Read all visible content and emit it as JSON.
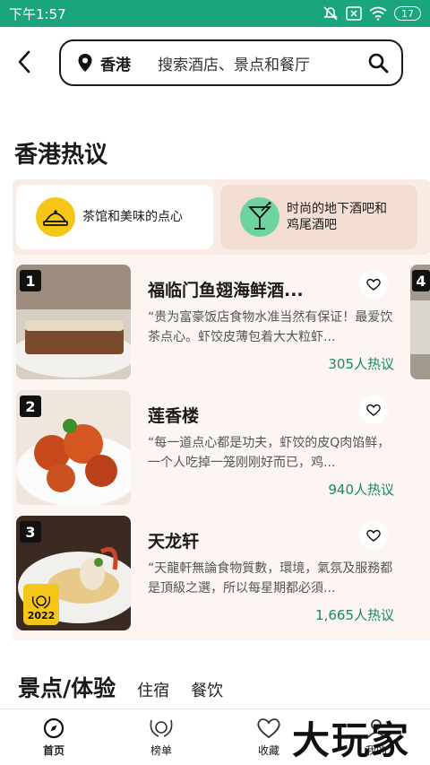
{
  "status_bar": {
    "time": "下午1:57",
    "battery": "17"
  },
  "search": {
    "location": "香港",
    "placeholder": "搜索酒店、景点和餐厅"
  },
  "section_title": "香港热议",
  "topics": [
    {
      "label": "茶馆和美味的点心",
      "icon": "dim-sum-icon",
      "color": "#f5c518"
    },
    {
      "label_line1": "时尚的地下酒吧和",
      "label_line2": "鸡尾酒吧",
      "icon": "cocktail-icon",
      "color": "#6fd3a0"
    }
  ],
  "cards": [
    {
      "rank": "1",
      "name": "福临门鱼翅海鲜酒...",
      "desc": "“贵为富豪饭店食物水准当然有保证！最爱饮茶点心。虾饺皮薄包着大大粒虾...",
      "count": "305人热议"
    },
    {
      "rank": "2",
      "name": "莲香楼",
      "desc": "“每一道点心都是功夫，虾饺的皮Q肉馅鲜，一个人吃掉一笼刚刚好而已，鸡...",
      "count": "940人热议"
    },
    {
      "rank": "3",
      "name": "天龙轩",
      "desc": "“天龍軒無論食物質數，環境，氣氛及服務都是頂級之選，所以每星期都必須...",
      "count": "1,665人热议",
      "award_year": "2022"
    }
  ],
  "peek_rank": "4",
  "category_tabs": {
    "main": "景点/体验",
    "tab2": "住宿",
    "tab3": "餐饮"
  },
  "bottom_nav": [
    {
      "label": "首页",
      "icon": "compass-icon"
    },
    {
      "label": "榜单",
      "icon": "laurel-icon"
    },
    {
      "label": "收藏",
      "icon": "heart-icon"
    },
    {
      "label": "我的",
      "icon": "profile-icon"
    }
  ],
  "watermark": "大玩家",
  "colors": {
    "status_bar": "#1aa57a",
    "accent_green": "#1a8a5c",
    "topic_bg": "#f8ece4"
  }
}
